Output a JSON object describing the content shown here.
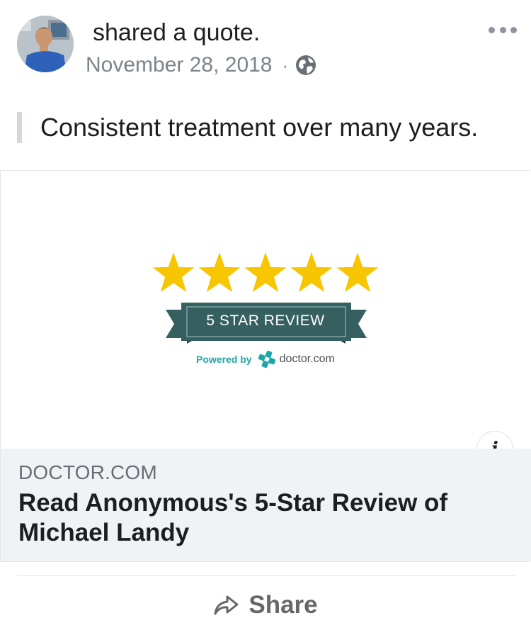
{
  "post": {
    "action_text": "shared a quote.",
    "date": "November 28, 2018",
    "separator": "·",
    "privacy_icon": "globe-icon",
    "more_icon": "more-options-icon",
    "quote": "Consistent treatment over many years."
  },
  "card": {
    "image": {
      "stars": 5,
      "star_color": "#f7c600",
      "banner_text": "5 STAR REVIEW",
      "banner_color": "#36605f",
      "powered_by": "Powered by",
      "brand_name": "doctor.com",
      "brand_color": "#1fa7a7"
    },
    "info_icon": "info-icon",
    "info_glyph": "i",
    "domain": "DOCTOR.COM",
    "title": "Read Anonymous's 5-Star Review of Michael Landy"
  },
  "actions": {
    "share_label": "Share",
    "share_icon": "share-arrow-icon"
  }
}
